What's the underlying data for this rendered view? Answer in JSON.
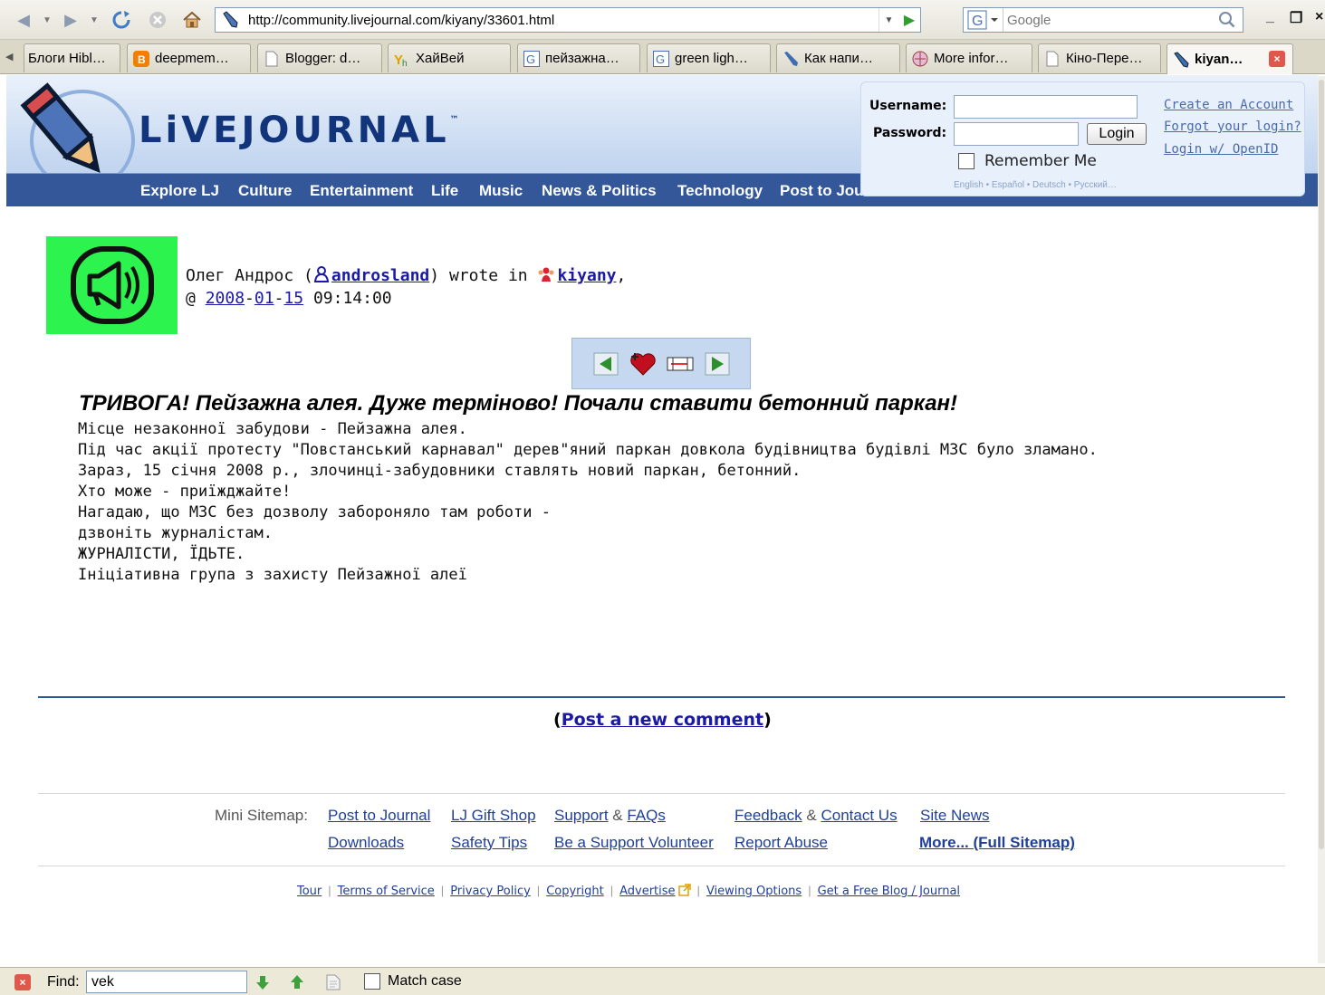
{
  "browser": {
    "url": "http://community.livejournal.com/kiyany/33601.html",
    "search_placeholder": "Google",
    "tabs": [
      {
        "label": "Блоги Hibl…"
      },
      {
        "label": "deepmem…"
      },
      {
        "label": "Blogger: d…"
      },
      {
        "label": "ХайВей"
      },
      {
        "label": "пейзажна…"
      },
      {
        "label": "green ligh…"
      },
      {
        "label": "Как напи…"
      },
      {
        "label": "More infor…"
      },
      {
        "label": "Кіно-Пере…"
      },
      {
        "label": "kiyan…"
      }
    ]
  },
  "header": {
    "logo_text": "LiVEJOURNAL",
    "trademark": "™",
    "nav": [
      "Explore LJ",
      "Culture",
      "Entertainment",
      "Life",
      "Music",
      "News & Politics",
      "Technology",
      "Post to Jou"
    ]
  },
  "login": {
    "username_label": "Username:",
    "password_label": "Password:",
    "login_button": "Login",
    "remember_label": "Remember Me",
    "languages": "English • Español • Deutsch • Русский…",
    "create_account": "Create an Account",
    "forgot_login": "Forgot your login?",
    "openid_login": "Login w/ OpenID"
  },
  "post": {
    "author_name": "Олег Андрос (",
    "author_user": "androsland",
    "wrote_in": ") wrote in ",
    "community": "kiyany",
    "comma": ",",
    "at": "@ ",
    "date_year": "2008",
    "date_month": "01",
    "date_day": "15",
    "time": " 09:14:00",
    "title": "ТРИВОГА! Пейзажна алея. Дуже терміново! Почали ставити бетонний паркан!",
    "body": [
      "Місце незаконної забудови - Пейзажна алея.",
      "Під час акції протесту \"Повстанський карнавал\" дерев\"яний паркан довкола будівництва будівлі МЗС було зламано.",
      "Зараз, 15 січня 2008 р., злочинці-забудовники ставлять новий паркан, бетонний.",
      "",
      "Хто може - приїжджайте!",
      "",
      "Нагадаю, що МЗС без дозволу забороняло там роботи -",
      "дзвоніть журналістам.",
      "",
      "ЖУРНАЛІСТИ, ЇДЬТЕ.",
      "",
      "Ініціативна група з захисту Пейзажної алеї"
    ],
    "comment_open": "(",
    "comment_link": "Post a new comment",
    "comment_close": ")"
  },
  "footer": {
    "sitemap_label": "Mini Sitemap:",
    "post_to_journal": "Post to Journal",
    "gift_shop": "LJ Gift Shop",
    "support": "Support",
    "faqs": "FAQs",
    "feedback": "Feedback",
    "contact": "Contact Us",
    "site_news": "Site News",
    "downloads": "Downloads",
    "safety_tips": "Safety Tips",
    "volunteer": "Be a Support Volunteer",
    "report_abuse": "Report Abuse",
    "more": "More... (Full Sitemap)",
    "amp": "&",
    "bottom": [
      "Tour",
      "Terms of Service",
      "Privacy Policy",
      "Copyright",
      "Advertise",
      "Viewing Options",
      "Get a Free Blog / Journal"
    ]
  },
  "findbar": {
    "label": "Find:",
    "value": "vek",
    "match_case": "Match case"
  }
}
